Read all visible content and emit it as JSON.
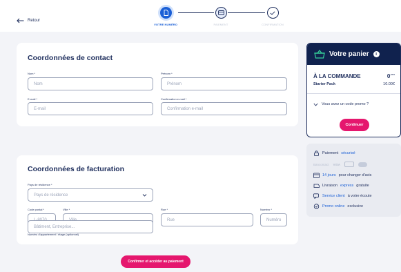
{
  "header": {
    "back_label": "Retour",
    "steps": [
      {
        "label": "VOTRE NUMÉRO"
      },
      {
        "label": "PAIEMENT"
      },
      {
        "label": "CONFIRMATION"
      }
    ]
  },
  "contact": {
    "title": "Coordonnées de contact",
    "nom": {
      "label": "Nom *",
      "placeholder": "Nom"
    },
    "prenom": {
      "label": "Prénom *",
      "placeholder": "Prénom"
    },
    "email": {
      "label": "E-mail *",
      "placeholder": "E-mail"
    },
    "email_confirm": {
      "label": "Confirmation e-mail *",
      "placeholder": "Confirmation e-mail"
    }
  },
  "billing": {
    "title": "Coordonnées de facturation",
    "pays": {
      "label": "Pays de résidence *",
      "placeholder": "Pays de résidence"
    },
    "code_postal": {
      "label": "Code postal *",
      "placeholder": "L-8070"
    },
    "ville": {
      "label": "Ville *",
      "placeholder": "Ville"
    },
    "rue": {
      "label": "Rue *",
      "placeholder": "Rue"
    },
    "numero": {
      "label": "Numéro *",
      "placeholder": "Numéro"
    },
    "appartement": {
      "label": "Numéro d'appartement / étage (optionnel)",
      "placeholder": "Bâtiment, Entreprise..."
    }
  },
  "submit_label": "Confirmer et accéder au paiement",
  "cart": {
    "title": "Votre panier",
    "info_glyph": "i",
    "order_label": "À LA COMMANDE",
    "order_total": "0",
    "order_total_suffix": ",00 €",
    "item_name": "Starter Pack",
    "item_price": "10.00€",
    "promo_label": "Vous avez un code promo ?",
    "continue_label": "Continuer"
  },
  "benefits": {
    "secure_prefix": "Paiement ",
    "secure_highlight": "sécurisé",
    "payment_logos": [
      "Bancontact",
      "VISA"
    ],
    "days_highlight": "14 jours",
    "days_suffix": " pour changer d'avis",
    "delivery_prefix": "Livraison ",
    "delivery_highlight": "express",
    "delivery_suffix": " gratuite",
    "service_highlight": "Service client",
    "service_suffix": " à votre écoute",
    "promo_highlight": "Promo online",
    "promo_suffix": " exclusive"
  },
  "colors": {
    "primary": "#1a5fd6",
    "navy": "#10224e",
    "accent_pink": "#e5176e",
    "background": "#f3f4f8"
  }
}
